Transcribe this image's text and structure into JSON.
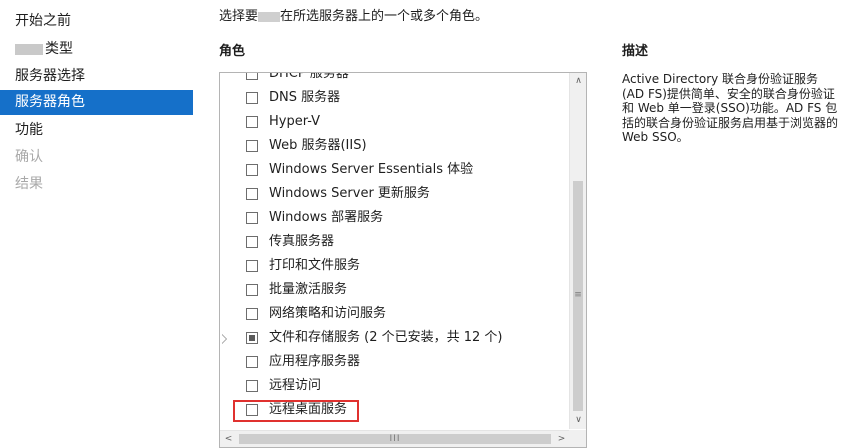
{
  "nav": {
    "items": [
      {
        "label": "开始之前",
        "state": "normal"
      },
      {
        "label": "类型",
        "state": "normal",
        "redacted_prefix": true
      },
      {
        "label": "服务器选择",
        "state": "normal"
      },
      {
        "label": "服务器角色",
        "state": "active"
      },
      {
        "label": "功能",
        "state": "normal"
      },
      {
        "label": "确认",
        "state": "disabled"
      },
      {
        "label": "结果",
        "state": "disabled"
      }
    ]
  },
  "intro": {
    "prefix": "选择要",
    "suffix": "在所选服务器上的一个或多个角色。"
  },
  "roles_heading": "角色",
  "description_heading": "描述",
  "roles": [
    {
      "label": "DHCP 服务器",
      "checked": false,
      "partial_view": true
    },
    {
      "label": "DNS 服务器",
      "checked": false
    },
    {
      "label": "Hyper-V",
      "checked": false
    },
    {
      "label": "Web 服务器(IIS)",
      "checked": false
    },
    {
      "label": "Windows Server Essentials 体验",
      "checked": false
    },
    {
      "label": "Windows Server 更新服务",
      "checked": false
    },
    {
      "label": "Windows 部署服务",
      "checked": false
    },
    {
      "label": "传真服务器",
      "checked": false
    },
    {
      "label": "打印和文件服务",
      "checked": false
    },
    {
      "label": "批量激活服务",
      "checked": false
    },
    {
      "label": "网络策略和访问服务",
      "checked": false
    },
    {
      "label": "文件和存储服务 (2 个已安装，共 12 个)",
      "checked": "partial",
      "expandable": true
    },
    {
      "label": "应用程序服务器",
      "checked": false
    },
    {
      "label": "远程访问",
      "checked": false
    },
    {
      "label": "远程桌面服务",
      "checked": false,
      "highlighted": true
    }
  ],
  "description": "Active Directory 联合身份验证服务 (AD FS)提供简单、安全的联合身份验证和 Web 单一登录(SSO)功能。AD FS 包括的联合身份验证服务启用基于浏览器的 Web SSO。",
  "scrollbar": {
    "up_glyph": "∧",
    "down_glyph": "∨",
    "left_glyph": "<",
    "right_glyph": ">",
    "v_grip": "≡",
    "h_grip": "III"
  },
  "colors": {
    "nav_active": "#1570c9",
    "highlight_border": "#e0312f",
    "disabled_text": "#a9a9a9"
  }
}
